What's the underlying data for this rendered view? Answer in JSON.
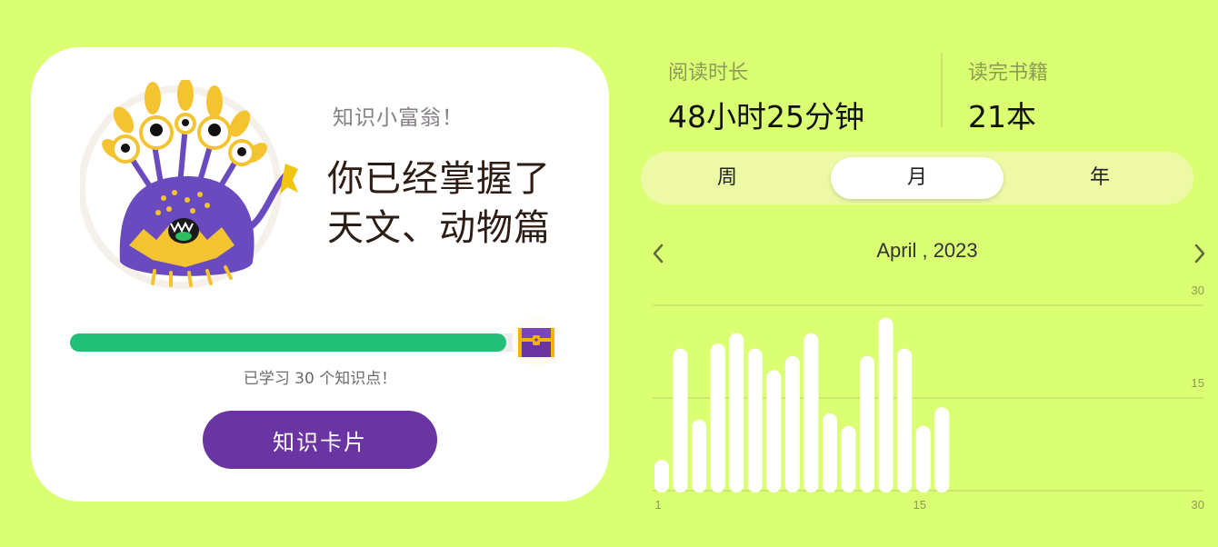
{
  "achievement": {
    "subtitle": "知识小富翁！",
    "headline_line1": "你已经掌握了",
    "headline_line2": "天文、动物篇",
    "progress_label": "已学习 30 个知识点！",
    "progress_fraction": 0.96,
    "button_label": "知识卡片"
  },
  "stats": {
    "reading_time_label": "阅读时长",
    "reading_time_value": "48小时25分钟",
    "books_label": "读完书籍",
    "books_value": "21本"
  },
  "period_tabs": [
    {
      "label": "周",
      "active": false
    },
    {
      "label": "月",
      "active": true
    },
    {
      "label": "年",
      "active": false
    }
  ],
  "month_label": "April , 2023",
  "colors": {
    "background": "#dbff73",
    "accent_purple": "#6a35a3",
    "progress_green": "#22bf78"
  },
  "chart_data": {
    "type": "bar",
    "x": [
      1,
      2,
      3,
      4,
      5,
      6,
      7,
      8,
      9,
      10,
      11,
      12,
      13,
      14,
      15,
      16
    ],
    "values": [
      5,
      23,
      11.5,
      23.8,
      25.5,
      23,
      19.5,
      21.8,
      25.5,
      12.5,
      10.5,
      21.8,
      28,
      23,
      10.5,
      13.5
    ],
    "y_ticks": [
      "30",
      "15"
    ],
    "x_ticks": [
      "1",
      "15",
      "30"
    ],
    "ylim": [
      0,
      30
    ],
    "xlim": [
      1,
      30
    ],
    "grid": true,
    "bar_color": "#ffffff"
  }
}
